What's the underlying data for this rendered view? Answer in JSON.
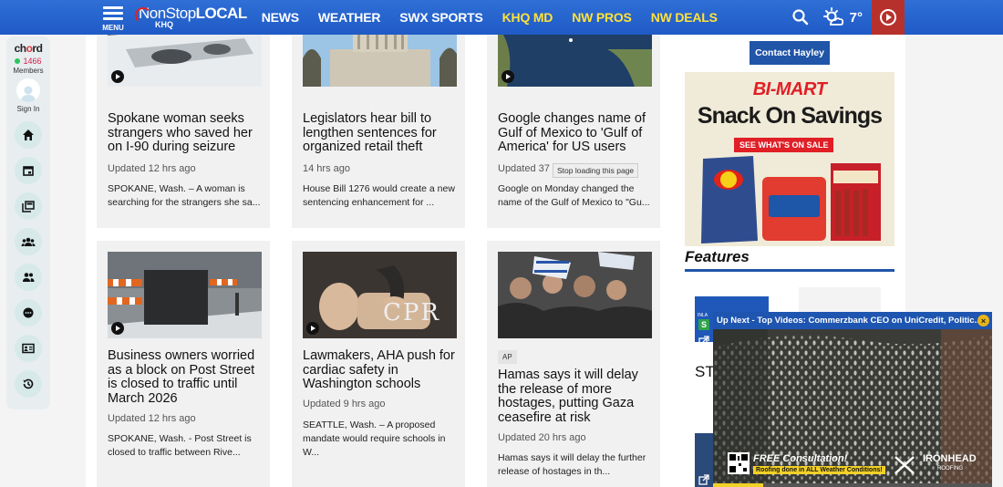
{
  "nav": {
    "menu_label": "MENU",
    "logo_line1": "NonStop",
    "logo_line1b": "LOCAL",
    "logo_line2": "KHQ",
    "items": [
      {
        "label": "NEWS",
        "yellow": false
      },
      {
        "label": "WEATHER",
        "yellow": false
      },
      {
        "label": "SWX SPORTS",
        "yellow": false
      },
      {
        "label": "KHQ MD",
        "yellow": true
      },
      {
        "label": "NW PROS",
        "yellow": true
      },
      {
        "label": "NW DEALS",
        "yellow": true
      }
    ],
    "temperature": "7°"
  },
  "sidebar": {
    "brand_a": "ch",
    "brand_o": "o",
    "brand_b": "rd",
    "members_count": "1466",
    "members_label": "Members",
    "signin_label": "Sign In"
  },
  "articles": [
    {
      "title": "Spokane woman seeks strangers who saved her on I-90 during seizure",
      "time": "Updated 12 hrs ago",
      "desc": "SPOKANE, Wash. – A woman is searching for the strangers she sa...",
      "video": true
    },
    {
      "title": "Legislators hear bill to lengthen sentences for organized retail theft",
      "time": "14 hrs ago",
      "desc": "House Bill 1276 would create a new sentencing enhancement for ...",
      "video": false
    },
    {
      "title": "Google changes name of Gulf of Mexico to 'Gulf of America' for US users",
      "time": "Updated 37 h",
      "desc": "Google on Monday changed the name of the Gulf of Mexico to \"Gu...",
      "video": true
    },
    {
      "title": "Business owners worried as a block on Post Street is closed to traffic until March 2026",
      "time": "Updated 12 hrs ago",
      "desc": "SPOKANE, Wash. - Post Street is closed to traffic between Rive...",
      "video": true
    },
    {
      "title": "Lawmakers, AHA push for cardiac safety in Washington schools",
      "time": "Updated 9 hrs ago",
      "desc": "SEATTLE, Wash. – A proposed mandate would require schools in W...",
      "video": true,
      "thumb_text": "CPR"
    },
    {
      "badge": "AP",
      "title": "Hamas says it will delay the release of more hostages, putting Gaza ceasefire at risk",
      "time": "Updated 20 hrs ago",
      "desc": "Hamas says it will delay the further release of hostages in th...",
      "video": false
    }
  ],
  "tooltip": "Stop loading this page",
  "right": {
    "contact_button": "Contact Hayley",
    "ad_brand": "BI-MART",
    "ad_headline": "Snack On Savings",
    "ad_cta": "SEE WHAT'S ON SALE",
    "features_heading": "Features",
    "feature_text": "ST",
    "feature_s": "S",
    "feature_label": "INLA"
  },
  "video": {
    "up_next": "Up Next - Top Videos: Commerzbank CEO on UniCredit, Politic...",
    "close": "×",
    "promo": "FREE Consultation!",
    "promo_sub": "Roofing done in ALL Weather Conditions!",
    "sponsor": "IRONHEAD",
    "sponsor_sub": "ROOFING",
    "progress": 0.18
  },
  "colors": {
    "nav_blue": "#1f5ac6",
    "nav_yellow": "#ffe23a",
    "play_red": "#b7312c",
    "accent_blue": "#2055a8"
  }
}
